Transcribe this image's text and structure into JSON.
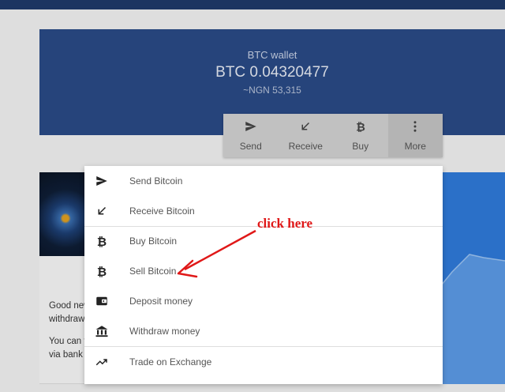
{
  "wallet": {
    "title": "BTC wallet",
    "balance": "BTC 0.04320477",
    "fiat": "~NGN 53,315"
  },
  "actions": [
    {
      "label": "Send",
      "icon": "send-icon"
    },
    {
      "label": "Receive",
      "icon": "receive-arrow-icon"
    },
    {
      "label": "Buy",
      "icon": "bitcoin-icon"
    },
    {
      "label": "More",
      "icon": "more-vertical-icon"
    }
  ],
  "menu": {
    "items": [
      {
        "label": "Send Bitcoin",
        "icon": "send-icon"
      },
      {
        "label": "Receive Bitcoin",
        "icon": "receive-arrow-icon"
      },
      {
        "label": "Buy Bitcoin",
        "icon": "bitcoin-icon"
      },
      {
        "label": "Sell Bitcoin",
        "icon": "bitcoin-icon"
      },
      {
        "label": "Deposit money",
        "icon": "wallet-icon"
      },
      {
        "label": "Withdraw money",
        "icon": "bank-icon"
      },
      {
        "label": "Trade on Exchange",
        "icon": "trending-up-icon"
      }
    ]
  },
  "news": {
    "line1": "Good new",
    "line2": "withdraw",
    "line3": "You can t",
    "line4": "via bank t"
  },
  "annotation": {
    "text": "click here",
    "color": "#e01818"
  },
  "colors": {
    "wallet_bg": "#2a4a86",
    "chart_bg": "#2f7ad9"
  }
}
